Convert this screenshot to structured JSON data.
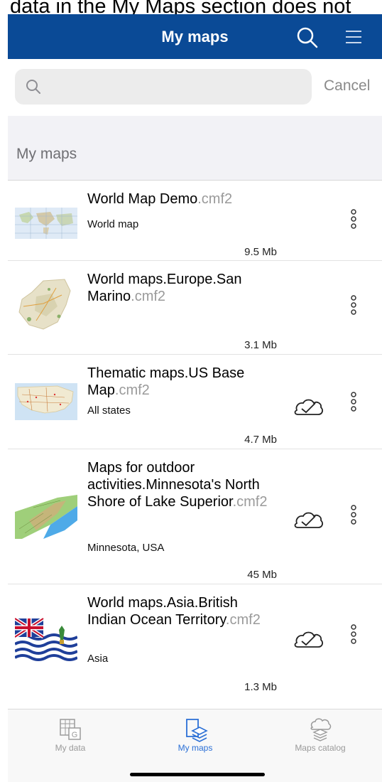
{
  "caption": "data in the My Maps section does not",
  "header": {
    "title": "My maps"
  },
  "search": {
    "placeholder": "",
    "cancel_label": "Cancel"
  },
  "section": {
    "title": "My maps"
  },
  "maps": [
    {
      "name": "World Map Demo",
      "ext": ".cmf2",
      "desc": "World map",
      "size": "9.5 Mb",
      "cloud": false
    },
    {
      "name": "World maps.Europe.San Marino",
      "ext": ".cmf2",
      "desc": "",
      "size": "3.1 Mb",
      "cloud": false
    },
    {
      "name": "Thematic maps.US Base Map",
      "ext": ".cmf2",
      "desc": "All states",
      "size": "4.7 Mb",
      "cloud": true
    },
    {
      "name": "Maps for outdoor activities.Minnesota's North Shore of Lake Superior",
      "ext": ".cmf2",
      "desc": "Minnesota, USA",
      "size": "45 Mb",
      "cloud": true
    },
    {
      "name": "World maps.Asia.British Indian Ocean Territory",
      "ext": ".cmf2",
      "desc": "Asia",
      "size": "1.3 Mb",
      "cloud": true
    }
  ],
  "tabs": [
    {
      "label": "My data",
      "icon": "my-data-icon",
      "active": false
    },
    {
      "label": "My maps",
      "icon": "my-maps-icon",
      "active": true
    },
    {
      "label": "Maps catalog",
      "icon": "maps-catalog-icon",
      "active": false
    }
  ],
  "colors": {
    "header": "#0a4a96",
    "active_tab": "#2a6fd6",
    "inactive_tab": "#9a9a9a"
  }
}
